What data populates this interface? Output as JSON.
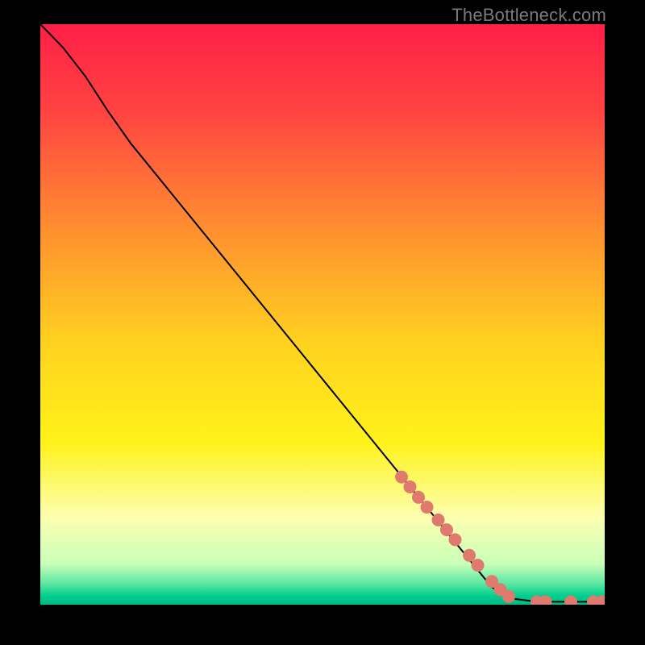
{
  "watermark": "TheBottleneck.com",
  "chart_data": {
    "type": "line",
    "title": "",
    "xlabel": "",
    "ylabel": "",
    "xlim": [
      0,
      100
    ],
    "ylim": [
      0,
      100
    ],
    "grid": false,
    "curve": {
      "name": "bottleneck-curve",
      "color": "#000000",
      "points": [
        {
          "x": 0,
          "y": 100
        },
        {
          "x": 4,
          "y": 96
        },
        {
          "x": 8,
          "y": 91
        },
        {
          "x": 12,
          "y": 85
        },
        {
          "x": 16,
          "y": 79.5
        },
        {
          "x": 80,
          "y": 3
        },
        {
          "x": 84,
          "y": 1
        },
        {
          "x": 88,
          "y": 0.5
        },
        {
          "x": 100,
          "y": 0.5
        }
      ]
    },
    "markers": {
      "name": "data-markers",
      "color": "#e07a6f",
      "radius_px": 8,
      "points": [
        {
          "x": 64,
          "y": 22
        },
        {
          "x": 65.5,
          "y": 20.3
        },
        {
          "x": 67,
          "y": 18.5
        },
        {
          "x": 68.5,
          "y": 16.8
        },
        {
          "x": 70.5,
          "y": 14.6
        },
        {
          "x": 72,
          "y": 12.9
        },
        {
          "x": 73.5,
          "y": 11.2
        },
        {
          "x": 76,
          "y": 8.5
        },
        {
          "x": 77.5,
          "y": 6.8
        },
        {
          "x": 80,
          "y": 4
        },
        {
          "x": 81.5,
          "y": 2.6
        },
        {
          "x": 83,
          "y": 1.4
        },
        {
          "x": 88,
          "y": 0.5
        },
        {
          "x": 89.5,
          "y": 0.5
        },
        {
          "x": 94,
          "y": 0.5
        },
        {
          "x": 98,
          "y": 0.5
        },
        {
          "x": 99.5,
          "y": 0.5
        }
      ]
    },
    "background_gradient": {
      "stops": [
        {
          "offset": 0.0,
          "color": "#ff1f47"
        },
        {
          "offset": 0.15,
          "color": "#ff4341"
        },
        {
          "offset": 0.35,
          "color": "#ff8e30"
        },
        {
          "offset": 0.55,
          "color": "#ffd21f"
        },
        {
          "offset": 0.72,
          "color": "#fff21a"
        },
        {
          "offset": 0.85,
          "color": "#fdffb0"
        },
        {
          "offset": 0.93,
          "color": "#c8ffb8"
        },
        {
          "offset": 0.965,
          "color": "#57e6a0"
        },
        {
          "offset": 0.985,
          "color": "#00cf8e"
        },
        {
          "offset": 1.0,
          "color": "#00b987"
        }
      ]
    }
  }
}
